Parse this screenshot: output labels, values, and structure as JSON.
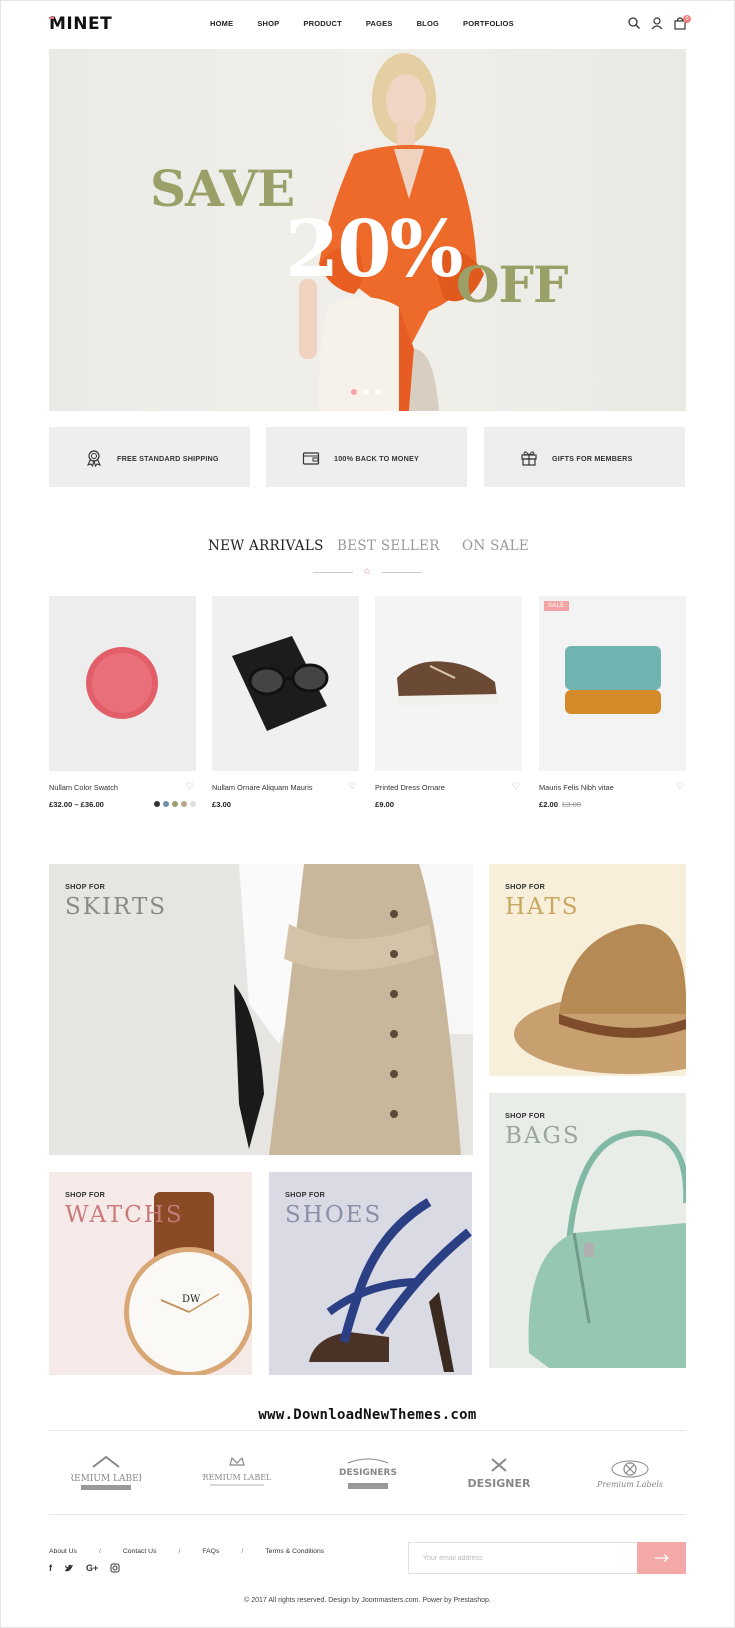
{
  "header": {
    "logo": "MINET",
    "nav": [
      "HOME",
      "SHOP",
      "PRODUCT",
      "PAGES",
      "BLOG",
      "PORTFOLIOS"
    ],
    "cart_count": "0"
  },
  "hero": {
    "save": "SAVE",
    "percent": "20%",
    "off": "OFF",
    "slides": 3,
    "active_slide": 1
  },
  "features": [
    {
      "label": "FREE STANDARD SHIPPING",
      "icon": "ribbon-icon"
    },
    {
      "label": "100% BACK TO MONEY",
      "icon": "wallet-icon"
    },
    {
      "label": "GIFTS FOR MEMBERS",
      "icon": "gift-icon"
    }
  ],
  "tabs": [
    "NEW ARRIVALS",
    "BEST SELLER",
    "ON SALE"
  ],
  "products": [
    {
      "name": "Nullam Color Swatch",
      "price": "£32.00 – £36.00",
      "old_price": "",
      "sale": "",
      "swatches": [
        "#333333",
        "#6b8fa8",
        "#9aa068",
        "#b9a58c",
        "#dddddd"
      ]
    },
    {
      "name": "Nullam Ornare Aliquam Mauris",
      "price": "£3.00",
      "old_price": "",
      "sale": ""
    },
    {
      "name": "Printed Dress Ornare",
      "price": "£9.00",
      "old_price": "",
      "sale": ""
    },
    {
      "name": "Mauris Felis Nibh vitae",
      "price": "£2.00",
      "old_price": "£3.00",
      "sale": "SALE"
    }
  ],
  "categories": {
    "shop_for": "SHOP FOR",
    "skirts": "SKIRTS",
    "hats": "HATS",
    "bags": "BAGS",
    "watches": "WATCHS",
    "shoes": "SHOES"
  },
  "watermark": "www.DownloadNewThemes.com",
  "brands": [
    "PREMIUM LABELS",
    "PREMIUM LABELS",
    "DESIGNERS",
    "DESIGNER",
    "Premium Labels"
  ],
  "footer": {
    "links": [
      "About Us",
      "Contact Us",
      "FAQs",
      "Terms & Conditions"
    ],
    "email_placeholder": "Your email address",
    "copyright": "© 2017 All rights reserved. Design by Joommasters.com. Power by Prestashop."
  },
  "colors": {
    "accent": "#f4a8a8",
    "olive": "#9aa068"
  }
}
